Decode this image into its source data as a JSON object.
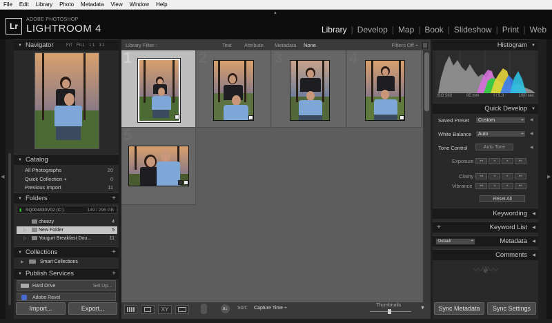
{
  "menu": [
    "File",
    "Edit",
    "Library",
    "Photo",
    "Metadata",
    "View",
    "Window",
    "Help"
  ],
  "identity": {
    "logo": "Lr",
    "vendor": "ADOBE PHOTOSHOP",
    "product": "LIGHTROOM 4"
  },
  "modules": [
    "Library",
    "Develop",
    "Map",
    "Book",
    "Slideshow",
    "Print",
    "Web"
  ],
  "active_module": "Library",
  "navigator": {
    "title": "Navigator",
    "zoom": [
      "FIT",
      "FILL",
      "1:1",
      "3:1"
    ]
  },
  "catalog": {
    "title": "Catalog",
    "items": [
      {
        "label": "All Photographs",
        "count": "20"
      },
      {
        "label": "Quick Collection  +",
        "count": "0"
      },
      {
        "label": "Previous Import",
        "count": "11"
      }
    ]
  },
  "folders": {
    "title": "Folders",
    "volume": "SQ004830V02 (C:)",
    "volume_size": "149 / 296 GB",
    "items": [
      {
        "label": "cheezy",
        "count": "4"
      },
      {
        "label": "New Folder",
        "count": "5"
      },
      {
        "label": "Yougurt Breakfast Dou...",
        "count": "11"
      }
    ]
  },
  "collections": {
    "title": "Collections",
    "items": [
      {
        "label": "Smart Collections"
      }
    ]
  },
  "publish": {
    "title": "Publish Services",
    "items": [
      {
        "label": "Hard Drive",
        "action": "Set Up..."
      },
      {
        "label": "Adobe Revel"
      }
    ]
  },
  "left_buttons": {
    "import": "Import...",
    "export": "Export..."
  },
  "filter": {
    "label": "Library Filter :",
    "options": [
      "Text",
      "Attribute",
      "Metadata",
      "None"
    ],
    "active": "None",
    "status": "Filters Off"
  },
  "grid": {
    "cells": [
      {
        "num": "1"
      },
      {
        "num": "2"
      },
      {
        "num": "3"
      },
      {
        "num": "4"
      },
      {
        "num": "5"
      }
    ],
    "selected": "1"
  },
  "toolbar": {
    "sort_label": "Sort:",
    "sort_value": "Capture Time",
    "thumbs_label": "Thumbnails"
  },
  "histogram": {
    "title": "Histogram",
    "iso": "ISO 560",
    "focal": "95 mm",
    "aperture": "f / 5.3",
    "shutter": "1/60 sec"
  },
  "quick_develop": {
    "title": "Quick Develop",
    "saved_preset_label": "Saved Preset",
    "saved_preset_value": "Custom",
    "wb_label": "White Balance",
    "wb_value": "Auto",
    "tone_label": "Tone Control",
    "auto_tone": "Auto Tone",
    "exposure": "Exposure",
    "clarity": "Clarity",
    "vibrance": "Vibrance",
    "reset": "Reset All"
  },
  "right_sections": {
    "keywording": "Keywording",
    "keyword_list": "Keyword List",
    "metadata": "Metadata",
    "metadata_preset": "Default",
    "comments": "Comments"
  },
  "right_buttons": {
    "sync_metadata": "Sync Metadata",
    "sync_settings": "Sync Settings"
  }
}
